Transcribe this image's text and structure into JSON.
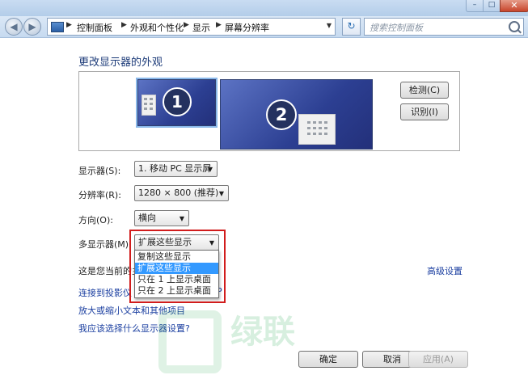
{
  "window": {
    "controls": {
      "minimize": "–",
      "maximize": "□",
      "close": "✕"
    }
  },
  "address": {
    "back_icon": "back-arrow",
    "forward_icon": "forward-arrow",
    "crumbs": [
      "控制面板",
      "外观和个性化",
      "显示",
      "屏幕分辨率"
    ],
    "search_placeholder": "搜索控制面板"
  },
  "page": {
    "title": "更改显示器的外观"
  },
  "preview": {
    "monitors": [
      {
        "number": "1",
        "selected": true
      },
      {
        "number": "2",
        "selected": false
      }
    ],
    "detect_button": "检测(C)",
    "identify_button": "识别(I)"
  },
  "settings": {
    "display_label": "显示器(S):",
    "display_value": "1. 移动 PC 显示屏",
    "resolution_label": "分辨率(R):",
    "resolution_value": "1280 × 800 (推荐)",
    "orientation_label": "方向(O):",
    "orientation_value": "横向",
    "multi_label": "多显示器(M):",
    "multi_value": "扩展这些显示",
    "multi_options": [
      "复制这些显示",
      "扩展这些显示",
      "只在 1 上显示桌面",
      "只在 2 上显示桌面"
    ],
    "multi_selected_index": 1,
    "current_main_prefix": "这是您当前的主",
    "advanced_link": "高级设置"
  },
  "links": {
    "projector": "连接到投影仪",
    "projector_suffix": "P",
    "text_size": "放大或缩小文本和其他项目",
    "which_settings": "我应该选择什么显示器设置?"
  },
  "watermark": "绿联",
  "footer": {
    "ok": "确定",
    "cancel": "取消",
    "apply": "应用(A)"
  },
  "colors": {
    "highlight_frame": "#d11c1c",
    "selected_option": "#3399ff",
    "link": "#1b3fa0"
  }
}
